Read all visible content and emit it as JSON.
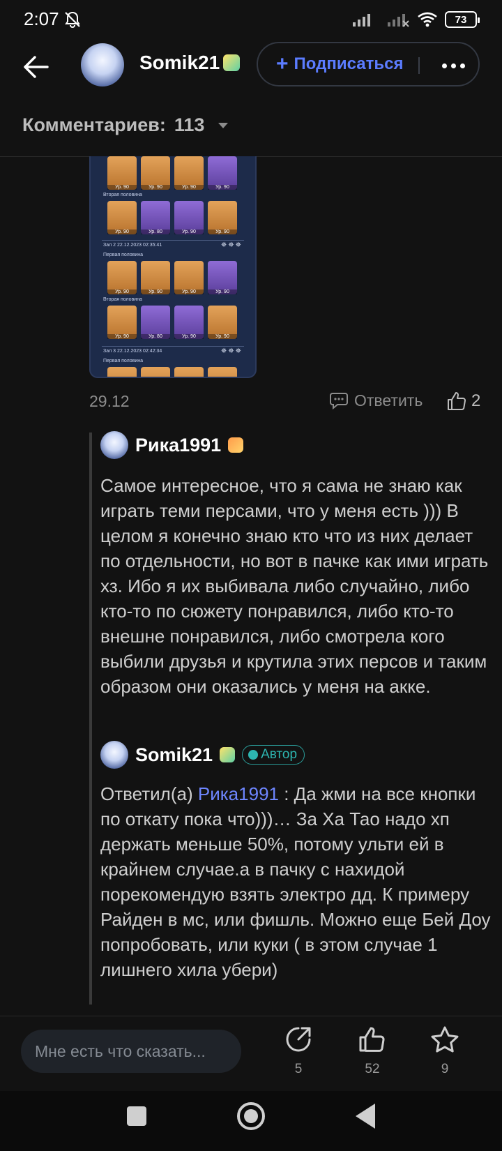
{
  "status": {
    "time": "2:07",
    "battery": "73"
  },
  "header": {
    "username": "Somik21",
    "subscribe_label": "Подписаться"
  },
  "comments": {
    "label": "Комментариев:",
    "count": "113"
  },
  "screenshot": {
    "level_labels": [
      "Ур. 90",
      "Ур. 90",
      "Ур. 90",
      "Ур. 90",
      "Ур. 90",
      "Ур. 80",
      "Ур. 90",
      "Ур. 90",
      "Ур. 90",
      "Ур. 90",
      "Ур. 90",
      "Ур. 90",
      "Ур. 90",
      "Ур. 80",
      "Ур. 90",
      "Ур. 90"
    ],
    "second_half": "Вторая половина",
    "first_half": "Первая половина",
    "hall2": "Зал 2   22.12.2023 02:35:41",
    "hall3": "Зал 3   22.12.2023 02:42:34"
  },
  "post_meta": {
    "date": "29.12",
    "reply_label": "Ответить",
    "likes": "2"
  },
  "reply1": {
    "name": "Рика1991",
    "text": "Самое интересное, что я сама не знаю как играть теми персами, что у меня есть ))) В целом я конечно знаю кто что из них делает по отдельности, но вот в пачке как ими играть хз. Ибо я их выбивала либо случайно, либо кто-то по сюжету понравился, либо кто-то внешне понравился, либо смотрела кого выбили друзья и крутила этих персов и таким образом они оказались у меня на акке."
  },
  "reply2": {
    "name": "Somik21",
    "author_tag": "Автор",
    "prefix": "Ответил(а)",
    "mention": "Рика1991",
    "text": " : Да жми на все кнопки по откату пока что)))… За Ха Тао надо хп держать меньше 50%, потому ульти ей в крайнем случае.а в пачку с нахидой порекомендую взять электро дд. К примеру Райден в мс, или фишль. Можно еще Бей Доу попробовать, или куки ( в этом случае 1 лишнего хила убери)"
  },
  "bottom_bar": {
    "input_placeholder": "Мне есть что сказать...",
    "share_count": "5",
    "like_count": "52",
    "favorite_count": "9"
  },
  "colors": {
    "accent": "#5b7cff",
    "author_tag": "#2db5b0",
    "background": "#121212"
  },
  "icons": [
    "back-arrow-icon",
    "mute-icon",
    "signal-icon",
    "wifi-icon",
    "battery-icon",
    "plus-icon",
    "more-icon",
    "chevron-down-icon",
    "comment-icon",
    "thumb-up-icon",
    "share-icon",
    "star-icon"
  ]
}
